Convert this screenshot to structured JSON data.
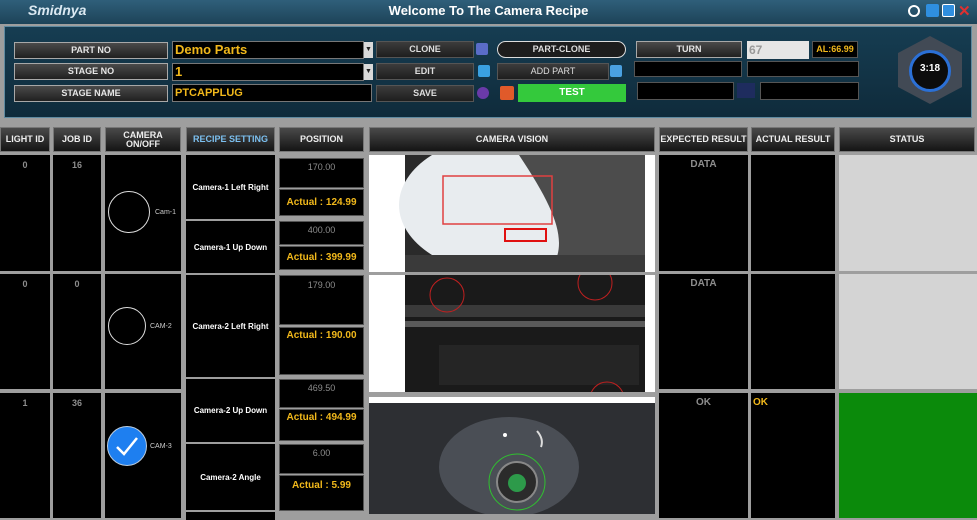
{
  "window": {
    "brand": "Smidnya",
    "title": "Welcome To The Camera Recipe"
  },
  "form": {
    "part_no_label": "PART NO",
    "part_no_value": "Demo Parts",
    "stage_no_label": "STAGE NO",
    "stage_no_value": "1",
    "stage_name_label": "STAGE NAME",
    "stage_name_value": "PTCAPPLUG"
  },
  "actions": {
    "clone": "CLONE",
    "edit": "EDIT",
    "save": "SAVE",
    "part_clone": "PART-CLONE",
    "add_part": "ADD PART",
    "test": "TEST",
    "turn": "TURN",
    "turn_value": "67",
    "al_value": "AL:66.99"
  },
  "timer": "3:18",
  "headers": {
    "light_id": "LIGHT ID",
    "job_id": "JOB ID",
    "camera_onoff": "CAMERA ON/OFF",
    "recipe_setting": "RECIPE SETTING",
    "position": "POSITION",
    "camera_vision": "CAMERA VISION",
    "expected_result": "EXPECTED RESULT",
    "actual_result": "ACTUAL RESULT",
    "status": "STATUS"
  },
  "rows": [
    {
      "light_id": "0",
      "job_id": "16",
      "cam": "Cam-1",
      "expected": "DATA",
      "actual": ""
    },
    {
      "light_id": "0",
      "job_id": "0",
      "cam": "CAM-2",
      "expected": "DATA",
      "actual": ""
    },
    {
      "light_id": "1",
      "job_id": "36",
      "cam": "CAM-3",
      "expected": "OK",
      "actual": "OK"
    }
  ],
  "recipes": [
    "Camera-1 Left Right",
    "Camera-1 Up Down",
    "Camera-2 Left Right",
    "Camera-2 Up Down",
    "Camera-2 Angle"
  ],
  "positions": [
    {
      "set": "170.00",
      "actual": "Actual : 124.99"
    },
    {
      "set": "400.00",
      "actual": "Actual : 399.99"
    },
    {
      "set": "179.00",
      "actual": "Actual : 190.00"
    },
    {
      "set": "469.50",
      "actual": "Actual : 494.99"
    },
    {
      "set": "6.00",
      "actual": "Actual : 5.99"
    }
  ],
  "colors": {
    "accent": "#f1b81b",
    "ok_status": "#0b8a0b",
    "test_button": "#34c93c"
  }
}
